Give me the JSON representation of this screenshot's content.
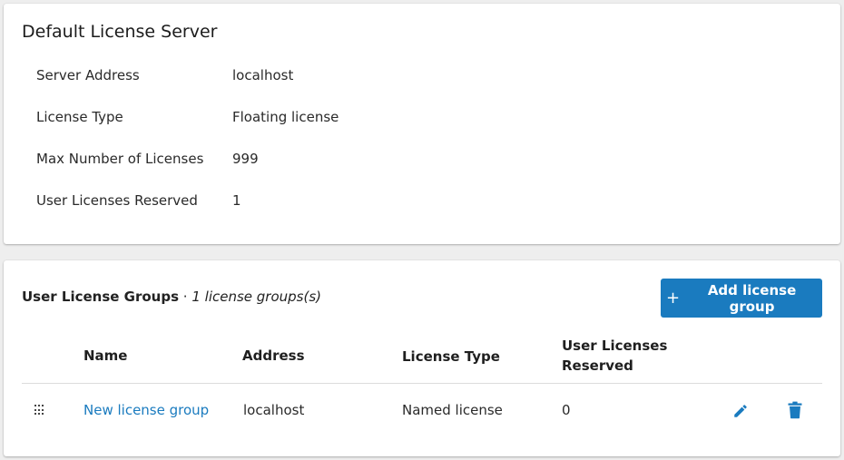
{
  "server": {
    "title": "Default License Server",
    "properties": [
      {
        "label": "Server Address",
        "value": "localhost"
      },
      {
        "label": "License Type",
        "value": "Floating license"
      },
      {
        "label": "Max Number of Licenses",
        "value": "999"
      },
      {
        "label": "User Licenses Reserved",
        "value": "1"
      }
    ]
  },
  "groups": {
    "heading": "User License Groups",
    "separator": " · ",
    "count_text": "1 license groups(s)",
    "add_button": {
      "icon": "plus-icon",
      "label": "Add license group"
    },
    "columns": {
      "name": "Name",
      "address": "Address",
      "license_type": "License Type",
      "reserved_line1": "User Licenses",
      "reserved_line2": "Reserved"
    },
    "rows": [
      {
        "name": "New license group",
        "address": "localhost",
        "license_type": "Named license",
        "reserved": "0",
        "actions": [
          "drag-handle-icon",
          "pencil-icon",
          "trash-icon"
        ]
      }
    ]
  },
  "colors": {
    "accent": "#1a7bbf",
    "background": "#eeeeee",
    "card": "#ffffff"
  }
}
